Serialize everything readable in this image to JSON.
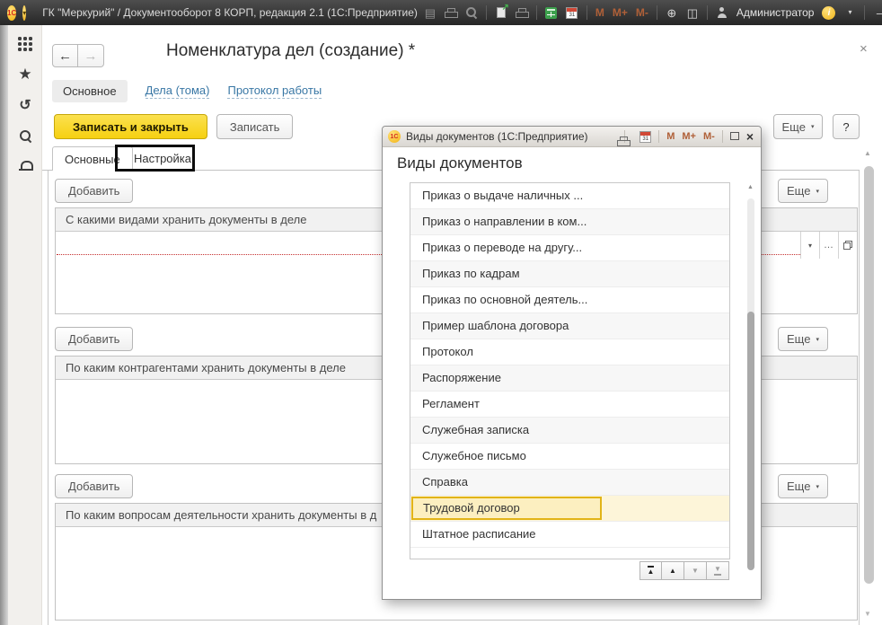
{
  "window": {
    "title": "ГК \"Меркурий\" / Документооборот 8 КОРП, редакция 2.1  (1С:Предприятие)",
    "user_name": "Администратор",
    "memory_buttons": [
      "M",
      "M+",
      "M-"
    ]
  },
  "icons": {
    "back_arrow": "←",
    "forward_arrow": "→",
    "dropdown": "▾",
    "ellipsis": "…",
    "close": "×",
    "minimize": "–",
    "star": "★",
    "history": "↺",
    "zoom_plus": "⊕",
    "columns": "◫",
    "up_triangle": "▲",
    "down_triangle": "▼",
    "floppy": "▤",
    "attach_arrow": "↗",
    "calendar_day": "31",
    "info": "i",
    "logo": "1С"
  },
  "form": {
    "title": "Номенклатура дел (создание) *",
    "nav_links": [
      {
        "label": "Основное",
        "active": true
      },
      {
        "label": "Дела (тома)",
        "active": false
      },
      {
        "label": "Протокол работы",
        "active": false
      }
    ],
    "commands": {
      "save_and_close": "Записать и закрыть",
      "save": "Записать",
      "more": "Еще",
      "help": "?"
    },
    "tabs": [
      {
        "label": "Основные",
        "selected": true
      },
      {
        "label": "Настройка",
        "annotated": true
      }
    ],
    "sections": [
      {
        "add": "Добавить",
        "more": "Еще",
        "header": "С какими видами хранить документы в деле"
      },
      {
        "add": "Добавить",
        "more": "Еще",
        "header": "По каким контрагентами хранить документы в деле"
      },
      {
        "add": "Добавить",
        "more": "Еще",
        "header": "По каким вопросам деятельности хранить документы в д"
      }
    ]
  },
  "dialog": {
    "window_title": "Виды документов  (1С:Предприятие)",
    "heading": "Виды документов",
    "memory_buttons": [
      "M",
      "M+",
      "M-"
    ],
    "items": [
      "Приказ о выдаче наличных ...",
      "Приказ о направлении в ком...",
      "Приказ о переводе на другу...",
      "Приказ по кадрам",
      "Приказ по основной деятель...",
      "Пример шаблона договора",
      "Протокол",
      "Распоряжение",
      "Регламент",
      "Служебная записка",
      "Служебное письмо",
      "Справка",
      "Трудовой договор",
      "Штатное расписание"
    ],
    "selected_item": "Трудовой договор",
    "selected_index": 12
  },
  "colors": {
    "accent_yellow": "#F6D011",
    "selection_yellow": "#FCEFC0",
    "selection_border": "#E2B418",
    "link_blue": "#3977A5",
    "required_red": "#C53030",
    "titlebar_dark": "#2B2B2B"
  }
}
